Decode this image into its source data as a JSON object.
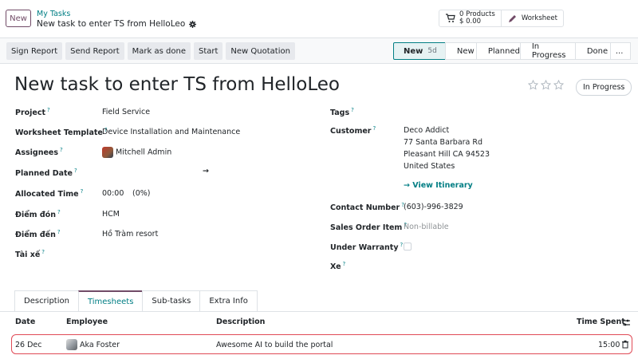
{
  "top": {
    "new_label": "New",
    "breadcrumb_parent": "My Tasks",
    "breadcrumb_current": "New task to enter TS from HelloLeo",
    "products_count": "0 Products",
    "products_amount": "$ 0.00",
    "worksheet_label": "Worksheet"
  },
  "actions": [
    "Sign Report",
    "Send Report",
    "Mark as done",
    "Start",
    "New Quotation"
  ],
  "stages": {
    "current": "New",
    "current_badge": "5d",
    "items": [
      "New",
      "Planned",
      "In Progress",
      "Done",
      "..."
    ]
  },
  "form": {
    "title": "New task to enter TS from HelloLeo",
    "priority_badge": "In Progress",
    "help_mark": "?",
    "left": [
      {
        "label": "Project",
        "value": "Field Service"
      },
      {
        "label": "Worksheet Template",
        "value": "Device Installation and Maintenance"
      },
      {
        "label": "Assignees",
        "value": "Mitchell Admin"
      },
      {
        "label": "Planned Date",
        "value": "→"
      },
      {
        "label": "Allocated Time",
        "value": "00:00",
        "extra": "(0%)"
      },
      {
        "label": "Điểm đón",
        "value": "HCM"
      },
      {
        "label": "Điểm đến",
        "value": "Hồ Tràm resort"
      },
      {
        "label": "Tài xế",
        "value": ""
      }
    ],
    "right": {
      "tags_label": "Tags",
      "customer_label": "Customer",
      "customer_lines": [
        "Deco Addict",
        "77 Santa Barbara Rd",
        "Pleasant Hill CA 94523",
        "United States"
      ],
      "itinerary": "→ View Itinerary",
      "contact_label": "Contact Number",
      "contact_value": "(603)-996-3829",
      "sales_label": "Sales Order Item",
      "sales_value": "Non-billable",
      "warranty_label": "Under Warranty",
      "xe_label": "Xe"
    }
  },
  "tabs": [
    "Description",
    "Timesheets",
    "Sub-tasks",
    "Extra Info"
  ],
  "timesheet": {
    "headers": {
      "date": "Date",
      "employee": "Employee",
      "description": "Description",
      "time": "Time Spent"
    },
    "rows": [
      {
        "date": "26 Dec",
        "employee": "Aka Foster",
        "description": "Awesome AI to build the portal",
        "time": "15:00"
      }
    ]
  },
  "colors": {
    "accent": "#017e84",
    "brand": "#714b67",
    "highlight": "#e04a56"
  }
}
